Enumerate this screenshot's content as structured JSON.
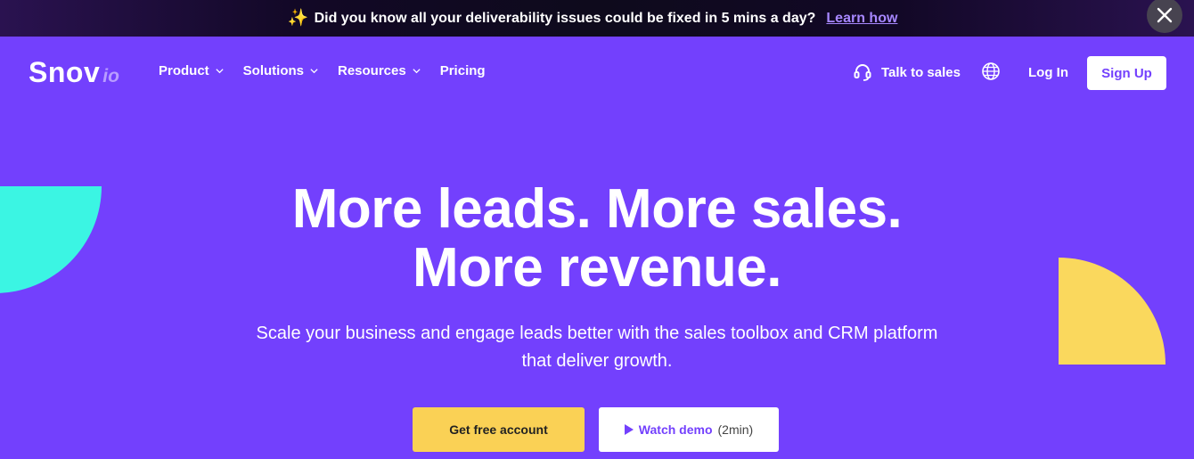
{
  "banner": {
    "sparkle_icon": "✨",
    "text": "Did you know all your deliverability issues could be fixed in 5 mins a day?",
    "link_label": "Learn how",
    "close_icon": "close-icon"
  },
  "header": {
    "logo_main": "Snov",
    "logo_suffix": "io",
    "nav": [
      {
        "label": "Product",
        "has_dropdown": true
      },
      {
        "label": "Solutions",
        "has_dropdown": true
      },
      {
        "label": "Resources",
        "has_dropdown": true
      },
      {
        "label": "Pricing",
        "has_dropdown": false
      }
    ],
    "talk_to_sales": "Talk to sales",
    "login": "Log In",
    "signup": "Sign Up"
  },
  "hero": {
    "title_line1": "More leads. More sales.",
    "title_line2": "More revenue.",
    "subtitle_line1": "Scale your business and engage leads better with the sales toolbox and CRM platform",
    "subtitle_line2": "that deliver growth.",
    "cta_primary": "Get free account",
    "cta_secondary": "Watch demo",
    "cta_secondary_duration": "(2min)"
  },
  "colors": {
    "brand": "#7340fd",
    "accent_yellow": "#fad155",
    "accent_teal": "#3bf5e3",
    "link": "#a787ff"
  }
}
